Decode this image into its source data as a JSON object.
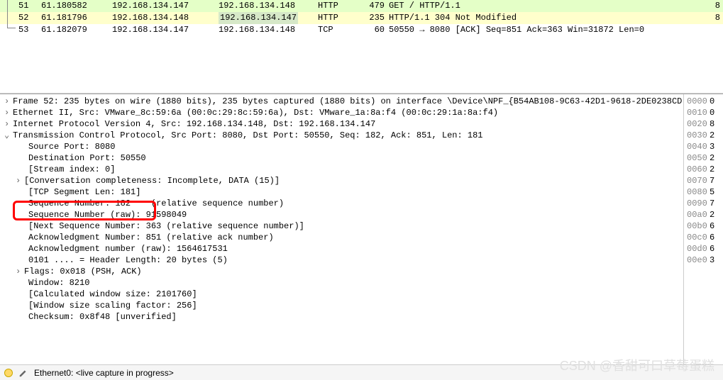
{
  "packets": [
    {
      "no": "51",
      "time": "61.180582",
      "src": "192.168.134.147",
      "dst": "192.168.134.148",
      "proto": "HTTP",
      "len": "479",
      "info": "GET / HTTP/1.1",
      "cls": "pr-green",
      "end": "8"
    },
    {
      "no": "52",
      "time": "61.181796",
      "src": "192.168.134.148",
      "dst": "192.168.134.147",
      "dsthl": true,
      "proto": "HTTP",
      "len": "235",
      "info": "HTTP/1.1 304 Not Modified",
      "cls": "pr-yellow",
      "end": "8"
    },
    {
      "no": "53",
      "time": "61.182079",
      "src": "192.168.134.147",
      "dst": "192.168.134.148",
      "proto": "TCP",
      "len": "60",
      "info": "50550 → 8080 [ACK] Seq=851 Ack=363 Win=31872 Len=0",
      "cls": "pr-white",
      "end": ""
    }
  ],
  "detail": {
    "frame": "Frame 52: 235 bytes on wire (1880 bits), 235 bytes captured (1880 bits) on interface \\Device\\NPF_{B54AB108-9C63-42D1-9618-2DE0238CD",
    "eth": "Ethernet II, Src: VMware_8c:59:6a (00:0c:29:8c:59:6a), Dst: VMware_1a:8a:f4 (00:0c:29:1a:8a:f4)",
    "ip": "Internet Protocol Version 4, Src: 192.168.134.148, Dst: 192.168.134.147",
    "tcp": "Transmission Control Protocol, Src Port: 8080, Dst Port: 50550, Seq: 182, Ack: 851, Len: 181",
    "srcport": "Source Port: 8080",
    "dstport": "Destination Port: 50550",
    "stream": "[Stream index: 0]",
    "conv": "[Conversation completeness: Incomplete, DATA (15)]",
    "seglen": "[TCP Segment Len: 181]",
    "seqnum": "Sequence Number: 182",
    "seqnum_suffix": "(relative sequence number)",
    "seqraw": "Sequence Number (raw): 91598049",
    "nextseq": "[Next Sequence Number: 363    (relative sequence number)]",
    "acknum": "Acknowledgment Number: 851    (relative ack number)",
    "ackraw": "Acknowledgment number (raw): 1564617531",
    "hdrlen": "0101 .... = Header Length: 20 bytes (5)",
    "flags": "Flags: 0x018 (PSH, ACK)",
    "window": "Window: 8210",
    "calcwin": "[Calculated window size: 2101760]",
    "winscale": "[Window size scaling factor: 256]",
    "checksum": "Checksum: 0x8f48 [unverified]"
  },
  "hex": [
    {
      "off": "0000",
      "v": "0"
    },
    {
      "off": "0010",
      "v": "0"
    },
    {
      "off": "0020",
      "v": "8"
    },
    {
      "off": "0030",
      "v": "2"
    },
    {
      "off": "0040",
      "v": "3"
    },
    {
      "off": "0050",
      "v": "2"
    },
    {
      "off": "0060",
      "v": "2"
    },
    {
      "off": "0070",
      "v": "7"
    },
    {
      "off": "0080",
      "v": "5"
    },
    {
      "off": "0090",
      "v": "7"
    },
    {
      "off": "00a0",
      "v": "2"
    },
    {
      "off": "00b0",
      "v": "6"
    },
    {
      "off": "00c0",
      "v": "6"
    },
    {
      "off": "00d0",
      "v": "6"
    },
    {
      "off": "00e0",
      "v": "3"
    }
  ],
  "status": {
    "iface": "Ethernet0: <live capture in progress>"
  },
  "watermark": "CSDN @香甜可口草莓蛋糕"
}
